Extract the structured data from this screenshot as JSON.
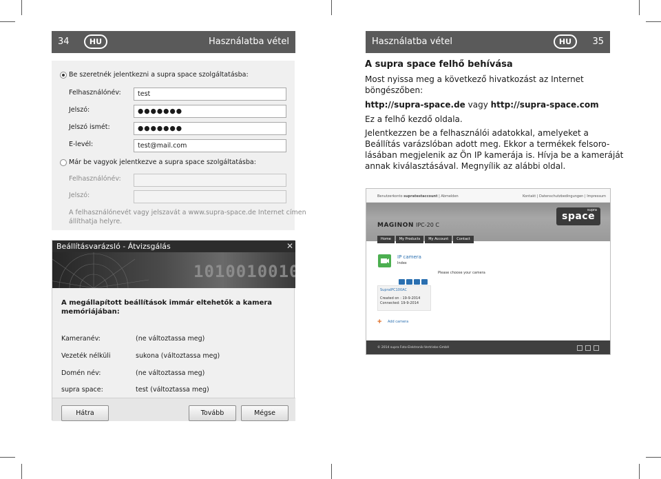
{
  "left_page": {
    "page_number": "34",
    "lang_badge": "HU",
    "header_title": "Használatba vétel"
  },
  "right_page": {
    "page_number": "35",
    "lang_badge": "HU",
    "header_title": "Használatba vétel"
  },
  "form": {
    "register_radio_label": "Be szeretnék jelentkezni a supra space szolgáltatásba:",
    "username_label": "Felhasználónév:",
    "username_value": "test",
    "password_label": "Jelszó:",
    "password_value": "●●●●●●●",
    "password_repeat_label": "Jelszó ismét:",
    "password_repeat_value": "●●●●●●●",
    "email_label": "E-levél:",
    "email_value": "test@mail.com",
    "existing_radio_label": "Már be vagyok jelentkezve a supra space szolgáltatásba:",
    "existing_username_label": "Felhasználónév:",
    "existing_password_label": "Jelszó:",
    "note_line1": "A felhasználónevét vagy jelszavát a www.supra-space.de Internet címen",
    "note_line2": "állíthatja helyre."
  },
  "wizard": {
    "title": "Beállításvarázsló - Átvizsgálás",
    "close_glyph": "✕",
    "banner_digits": "1010010010",
    "heading_line1": "A megállapított beállítások immár eltehetők a kamera",
    "heading_line2": "memóriájában:",
    "rows": [
      {
        "label": "Kameranév:",
        "value": "(ne változtassa meg)"
      },
      {
        "label": "Vezeték nélküli",
        "value": "sukona (változtassa meg)"
      },
      {
        "label": "Domén név:",
        "value": "(ne változtassa meg)"
      },
      {
        "label": "supra space:",
        "value": "test (változtassa meg)"
      }
    ],
    "back_button": "Hátra",
    "next_button": "Tovább",
    "cancel_button": "Mégse"
  },
  "article": {
    "title": "A supra space felhő behívása",
    "p1_line1": "Most nyissa meg a következő hivatkozást az Internet",
    "p1_line2": "böngészőben:",
    "url1": "http://supra-space.de",
    "or_word": " vagy ",
    "url2": "http://supra-space.com",
    "p2": "Ez a felhő kezdő oldala.",
    "p3_line1": "Jelentkezzen be a felhasználói adatokkal, amelyeket a",
    "p3_line2": "Beállítás varázslóban adott meg. Ekkor a termékek felsoro-",
    "p3_line3": "lásában megjelenik az Ön IP kamerája is. Hívja be a kameráját",
    "p3_line4": "annak kiválasztásával. Megnyílik az alábbi oldal."
  },
  "browser": {
    "top_left_prefix": "Benutzerkonto ",
    "top_left_account": "supratestaccount",
    "top_left_suffix": " | Abmelden",
    "top_right": "Kontakt | Datenschutzbedingungen | Impressum",
    "brand": "MAGINON",
    "model": "IPC-20 C",
    "logo_small": "supra",
    "logo_big": "space",
    "menu": [
      "Home",
      "My Products",
      "My Account",
      "Contact"
    ],
    "camera_title": "IP camera",
    "camera_sub": "Index",
    "choose_text": "Please choose your camera",
    "device_name": "SupraIPC100AC",
    "created": "Created on : 19-9-2014",
    "connected": "Connected: 19-9-2014",
    "add_camera": "Add camera",
    "footer": "© 2014 supra Foto-Elektronik-Vertriebs-GmbH",
    "accent_color": "#4caf50",
    "link_color": "#2a6fb0",
    "add_color": "#e0702a"
  }
}
